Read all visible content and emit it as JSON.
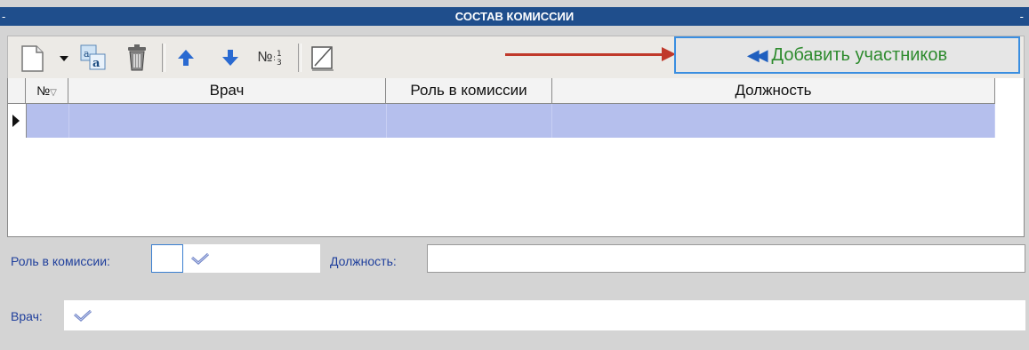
{
  "titlebar": {
    "title": "СОСТАВ КОМИССИИ",
    "left_mark": "-",
    "right_mark": "-"
  },
  "toolbar": {
    "icons": [
      "new-document-icon",
      "dropdown-arrow-icon",
      "rename-icon",
      "trash-icon",
      "arrow-up-icon",
      "arrow-down-icon",
      "numbering-icon",
      "edit-icon"
    ],
    "numbering_label": "№",
    "add_button": {
      "label": "Добавить участников",
      "chevrons": "«"
    }
  },
  "grid": {
    "columns": [
      "№",
      "Врач",
      "Роль в комиссии",
      "Должность"
    ],
    "rows": [
      {
        "num": "",
        "doctor": "",
        "role": "",
        "position": ""
      }
    ]
  },
  "form": {
    "role_label": "Роль в комиссии:",
    "position_label": "Должность:",
    "doctor_label": "Врач:",
    "role_value": "",
    "position_value": "",
    "doctor_value": ""
  },
  "colors": {
    "titlebar_bg": "#1f4e8c",
    "selected_row": "#b5bfed",
    "add_button_text": "#2e8b2e",
    "label_text": "#1f3f9c",
    "annotation_arrow": "#c0392b"
  }
}
